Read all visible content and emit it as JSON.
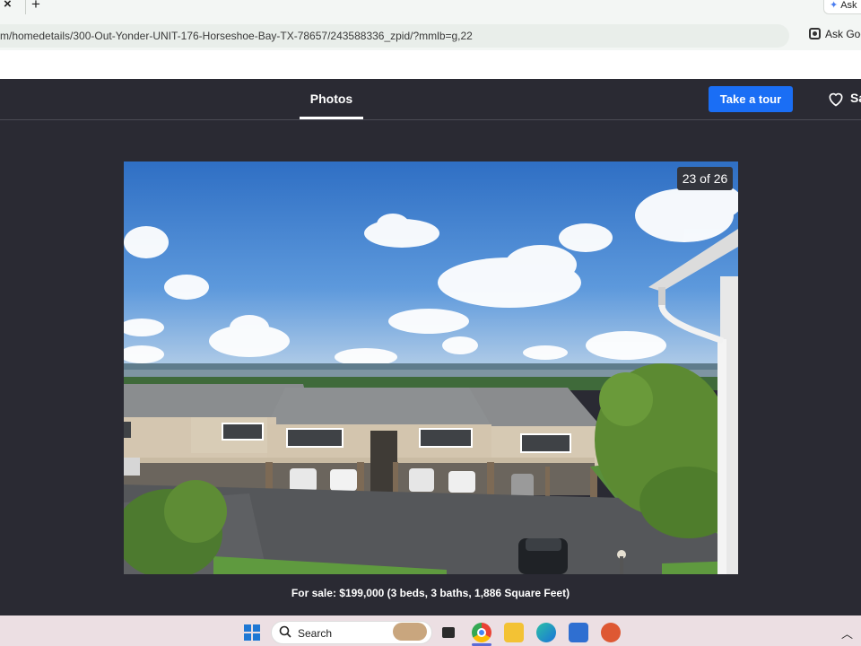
{
  "browser": {
    "tab_close": "×",
    "new_tab": "+",
    "ask_gemini_top": "Ask",
    "url": "m/homedetails/300-Out-Yonder-UNIT-176-Horseshoe-Bay-TX-78657/243588336_zpid/?mmlb=g,22",
    "ask_google": "Ask Goo"
  },
  "header": {
    "tab_photos": "Photos",
    "tour_button": "Take a tour",
    "save_label": "Sa"
  },
  "photo": {
    "counter": "23 of 26",
    "caption": "For sale: $199,000 (3 beds, 3 baths, 1,886 Square Feet)"
  },
  "taskbar": {
    "search_text": "Search",
    "icons": [
      "start-icon",
      "search-icon",
      "task-view-icon",
      "chrome-icon",
      "file-explorer-icon",
      "edge-icon",
      "store-icon",
      "duckduckgo-icon"
    ]
  },
  "colors": {
    "accent": "#1a6ef5",
    "page_bg": "#2a2a33"
  }
}
